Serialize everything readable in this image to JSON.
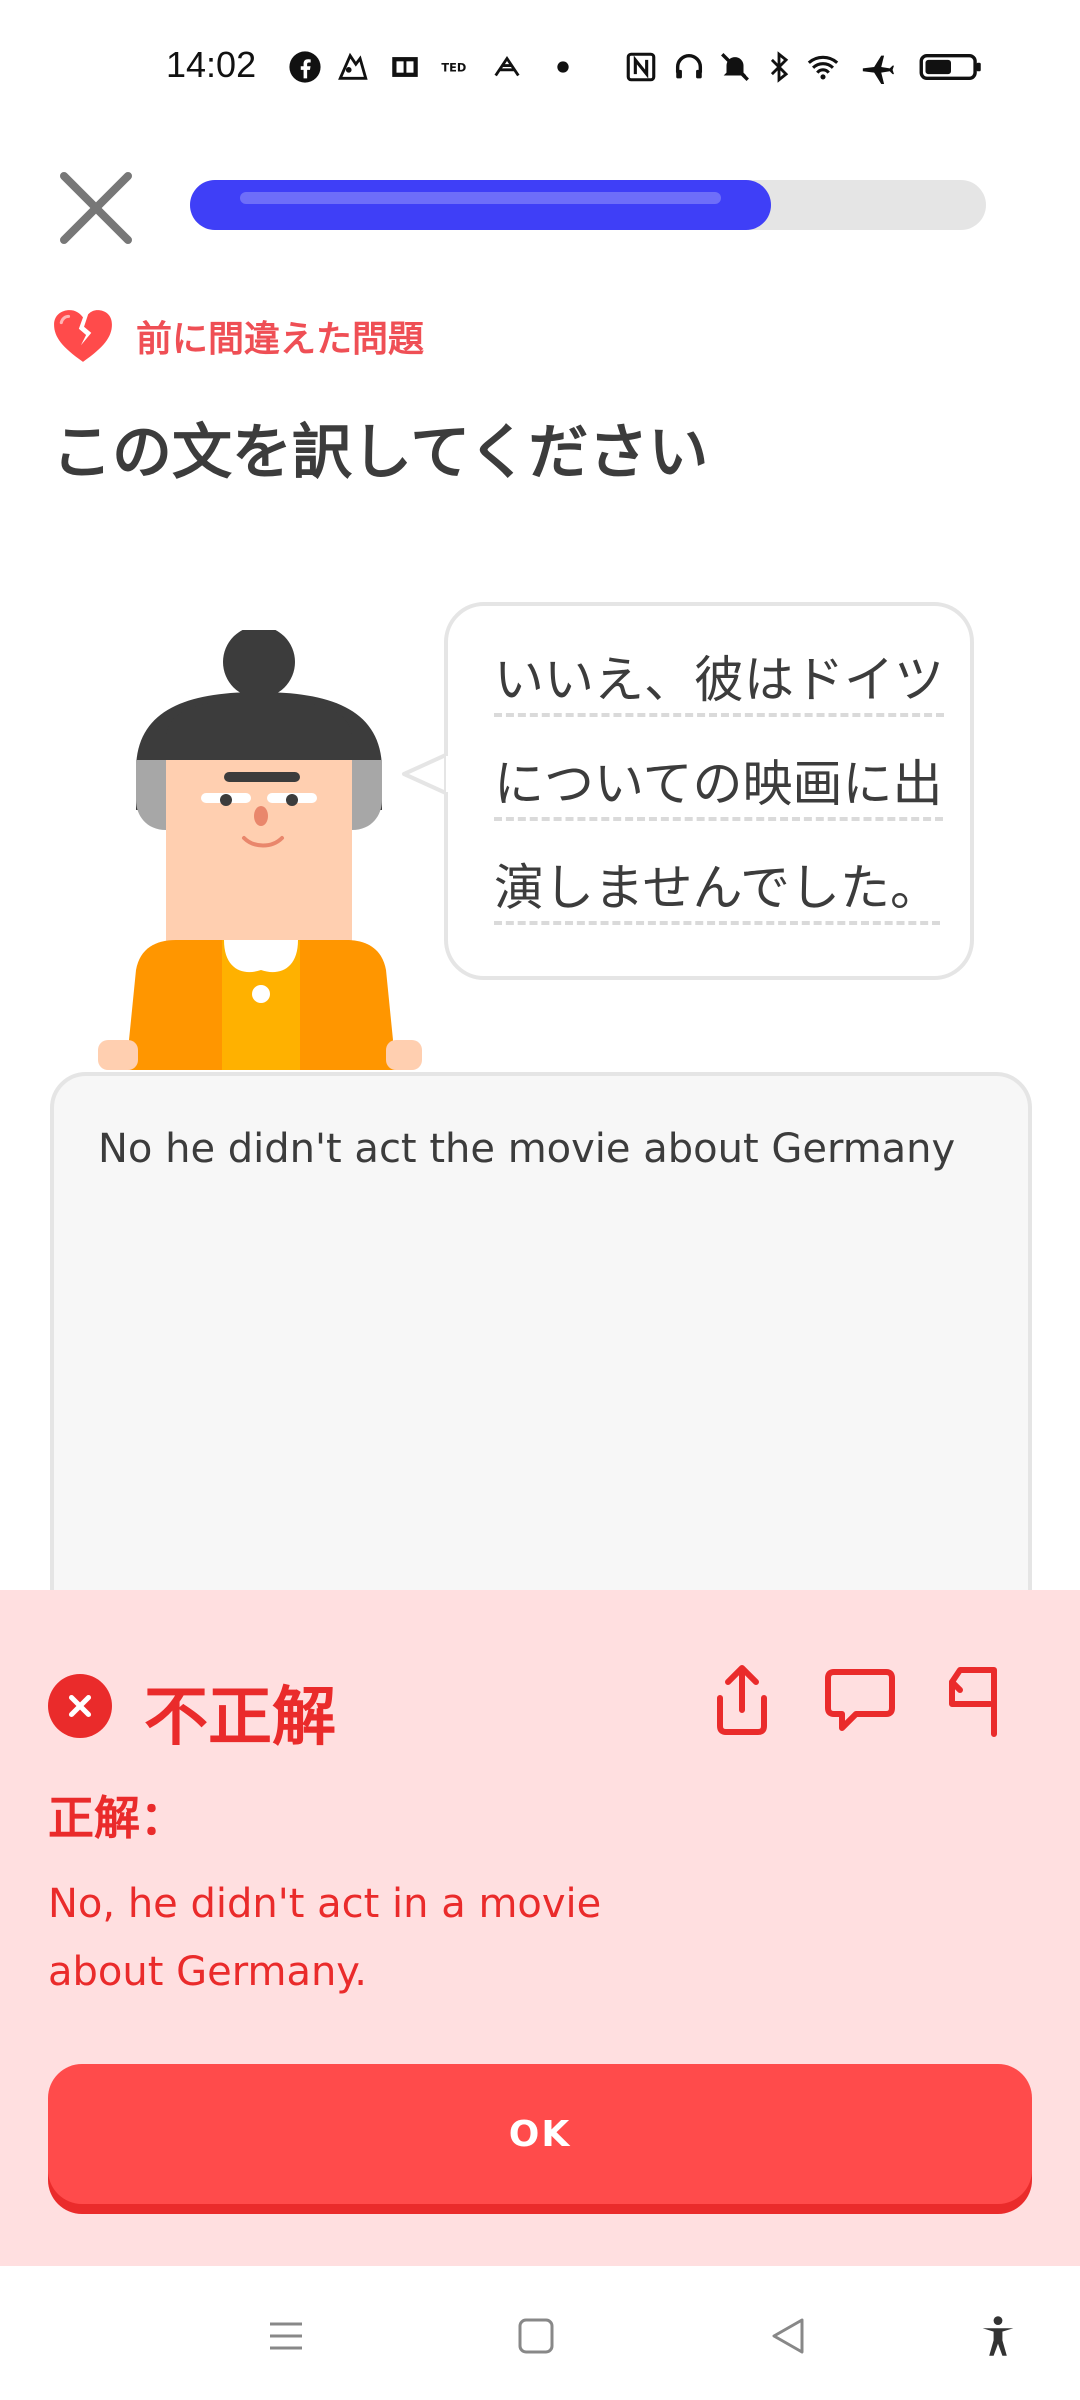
{
  "status_bar": {
    "time": "14:02",
    "left_icons": [
      "facebook-icon",
      "app-icon",
      "book-icon",
      "ted-icon",
      "app-icon-2",
      "dot-icon"
    ],
    "right_icons": [
      "nfc-icon",
      "headphones-icon",
      "mute-icon",
      "bluetooth-icon",
      "wifi-icon",
      "airplane-icon",
      "battery-icon"
    ]
  },
  "top_bar": {
    "progress": 0.73
  },
  "mistake_label": "前に間違えた問題",
  "instruction": "この文を訳してください",
  "prompt_lines": [
    "いいえ、彼はドイツ",
    "についての映画に出",
    "演しませんでした。"
  ],
  "answer": {
    "text": "No he didn't act the movie about Germany"
  },
  "feedback": {
    "status": "不正解",
    "solution_label": "正解：",
    "solution": "No, he didn't act in a movie about Germany.",
    "ok_label": "OK"
  },
  "colors": {
    "accent_blue": "#3f3ff7",
    "error_red": "#ea2b2b",
    "feedback_bg": "#ffdfe0",
    "button_red": "#ff4b4b"
  }
}
